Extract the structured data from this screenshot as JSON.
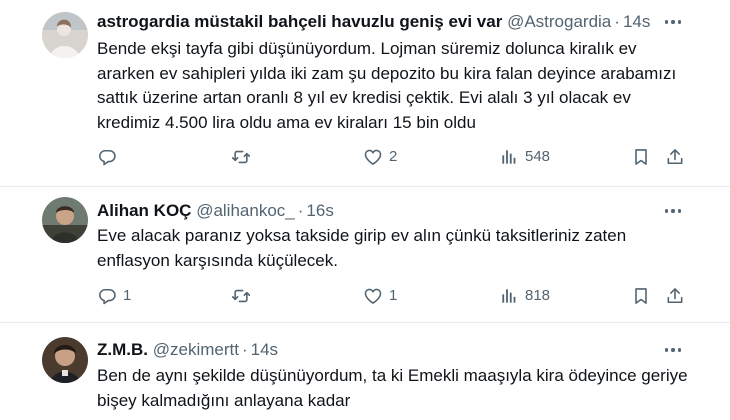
{
  "tweets": [
    {
      "name": "astrogardia müstakil bahçeli havuzlu geniş evi var",
      "handle": "@Astrogardia",
      "time": "14s",
      "text": "Bende ekşi tayfa gibi düşünüyordum. Lojman süremiz dolunca kiralık ev ararken ev sahipleri yılda iki zam şu depozito bu kira falan deyince arabamızı sattık üzerine artan oranlı 8 yıl ev kredisi çektik. Evi alalı 3 yıl olacak ev kredimiz 4.500 lira oldu ama ev kiraları 15 bin oldu",
      "replies": "",
      "retweets": "",
      "likes": "2",
      "views": "548"
    },
    {
      "name": "Alihan KOÇ",
      "handle": "@alihankoc_",
      "time": "16s",
      "text": "Eve alacak paranız yoksa takside girip ev alın çünkü taksitleriniz zaten enflasyon karşısında küçülecek.",
      "replies": "1",
      "retweets": "",
      "likes": "1",
      "views": "818"
    },
    {
      "name": "Z.M.B.",
      "handle": "@zekimertt",
      "time": "14s",
      "text": "Ben de aynı şekilde düşünüyordum, ta ki Emekli maaşıyla kira ödeyince geriye bişey kalmadığını anlayana kadar"
    }
  ],
  "separator": "·",
  "icons": {
    "reply": "reply-icon",
    "retweet": "retweet-icon",
    "like": "heart-icon",
    "views": "views-icon",
    "bookmark": "bookmark-icon",
    "share": "share-icon",
    "more": "more-icon"
  },
  "colors": {
    "text": "#0f1419",
    "secondary": "#536471",
    "divider": "#e6ecf0"
  }
}
